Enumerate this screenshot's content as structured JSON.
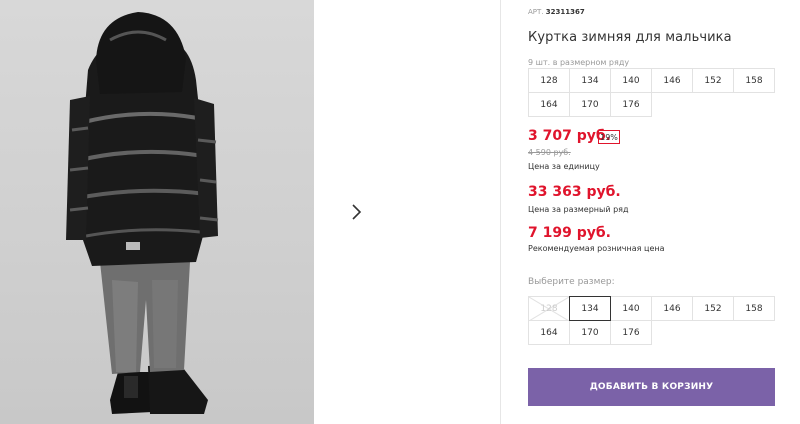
{
  "product": {
    "article_label": "АРТ.",
    "article": "32311367",
    "title": "Куртка зимняя для мальчика"
  },
  "gallery": {
    "next_icon": "chevron-right-icon"
  },
  "size_row": {
    "note": "9 шт. в размерном ряду",
    "sizes": [
      "128",
      "134",
      "140",
      "146",
      "152",
      "158",
      "164",
      "170",
      "176"
    ]
  },
  "prices": {
    "unit_price": "3 707 руб.",
    "discount": "19%",
    "old_price": "4 590 руб.",
    "unit_caption": "Цена за единицу",
    "row_price": "33 363 руб.",
    "row_caption": "Цена за размерный ряд",
    "retail_price": "7 199 руб.",
    "retail_caption": "Рекомендуемая розничная цена",
    "accent_color": "#e0142c"
  },
  "size_select": {
    "label": "Выберите размер:",
    "sizes": [
      "128",
      "134",
      "140",
      "146",
      "152",
      "158",
      "164",
      "170",
      "176"
    ],
    "selected": "134",
    "unavailable": [
      "128"
    ]
  },
  "cart": {
    "button_label": "ДОБАВИТЬ В КОРЗИНУ",
    "color": "#7b62a8"
  }
}
